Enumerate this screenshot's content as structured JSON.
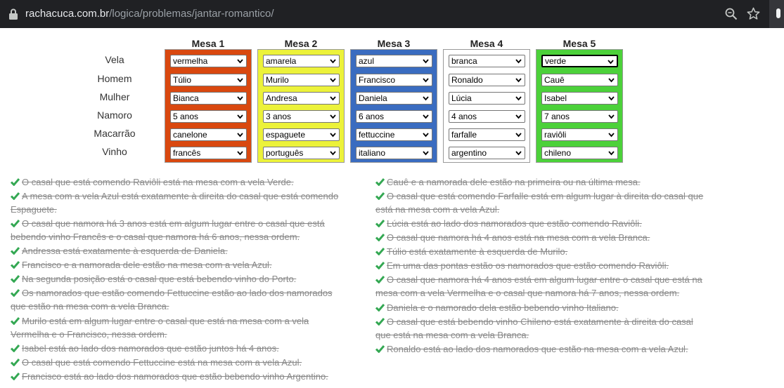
{
  "browser": {
    "url_host": "rachacuca.com.br",
    "url_path": "/logica/problemas/jantar-romantico/"
  },
  "row_labels": [
    "Vela",
    "Homem",
    "Mulher",
    "Namoro",
    "Macarrão",
    "Vinho"
  ],
  "mesas": [
    {
      "title": "Mesa 1",
      "color": "#d9480f",
      "values": [
        "vermelha",
        "Túlio",
        "Bianca",
        "5 anos",
        "canelone",
        "francês"
      ]
    },
    {
      "title": "Mesa 2",
      "color": "#ecf23a",
      "values": [
        "amarela",
        "Murilo",
        "Andresa",
        "3 anos",
        "espaguete",
        "português"
      ]
    },
    {
      "title": "Mesa 3",
      "color": "#3a6cc0",
      "values": [
        "azul",
        "Francisco",
        "Daniela",
        "6 anos",
        "fettuccine",
        "italiano"
      ]
    },
    {
      "title": "Mesa 4",
      "color": "#ffffff",
      "values": [
        "branca",
        "Ronaldo",
        "Lúcia",
        "4 anos",
        "farfalle",
        "argentino"
      ]
    },
    {
      "title": "Mesa 5",
      "color": "#4cd13a",
      "values": [
        "verde",
        "Cauê",
        "Isabel",
        "7 anos",
        "raviôli",
        "chileno"
      ]
    }
  ],
  "clues_left": [
    [
      "O casal que está comendo Raviôli está na mesa com a vela Verde."
    ],
    [
      "A mesa com a vela Azul está exatamente à direita do casal que está comendo",
      "Espaguete."
    ],
    [
      "O casal que namora há 3 anos está em algum lugar entre o casal que está",
      "bebendo vinho Francês e o casal que namora há 6 anos, nessa ordem."
    ],
    [
      "Andressa está exatamente à esquerda de Daniela."
    ],
    [
      "Francisco e a namorada dele estão na mesa com a vela Azul."
    ],
    [
      "Na segunda posição está o casal que está bebendo vinho do Porto."
    ],
    [
      "Os namorados que estão comendo Fettuccine estão ao lado dos namorados",
      "que estão na mesa com a vela Branca."
    ],
    [
      "Murilo está em algum lugar entre o casal que está na mesa com a vela",
      "Vermelha e o Francisco, nessa ordem."
    ],
    [
      "Isabel está ao lado dos namorados que estão juntos há 4 anos."
    ],
    [
      "O casal que está comendo Fettuccine está na mesa com a vela Azul."
    ],
    [
      "Francisco está ao lado dos namorados que estão bebendo vinho Argentino."
    ]
  ],
  "clues_right": [
    [
      "Cauê e a namorada dele estão na primeira ou na última mesa."
    ],
    [
      "O casal que está comendo Farfalle está em algum lugar à direita do casal que",
      "está na mesa com a vela Azul."
    ],
    [
      "Lúcia está ao lado dos namorados que estão comendo Raviôli."
    ],
    [
      "O casal que namora há 4 anos está na mesa com a vela Branca."
    ],
    [
      "Túlio está exatamente à esquerda de Murilo."
    ],
    [
      "Em uma das pontas estão os namorados que estão comendo Raviôli."
    ],
    [
      "O casal que namora há 4 anos está em algum lugar entre o casal que está na",
      "mesa com a vela Vermelha e o casal que namora há 7 anos, nessa ordem."
    ],
    [
      "Daniela e o namorado dela estão bebendo vinho Italiano."
    ],
    [
      "O casal que está bebendo vinho Chileno está exatamente à direita do casal",
      "que está na mesa com a vela Branca."
    ],
    [
      "Ronaldo está ao lado dos namorados que estão na mesa com a vela Azul."
    ]
  ],
  "icons": {
    "lock": "lock-icon",
    "zoom": "zoom-icon",
    "star": "star-icon",
    "check": "check-icon",
    "dropdown": "chevron-down-icon"
  },
  "check_color": "#34a853"
}
